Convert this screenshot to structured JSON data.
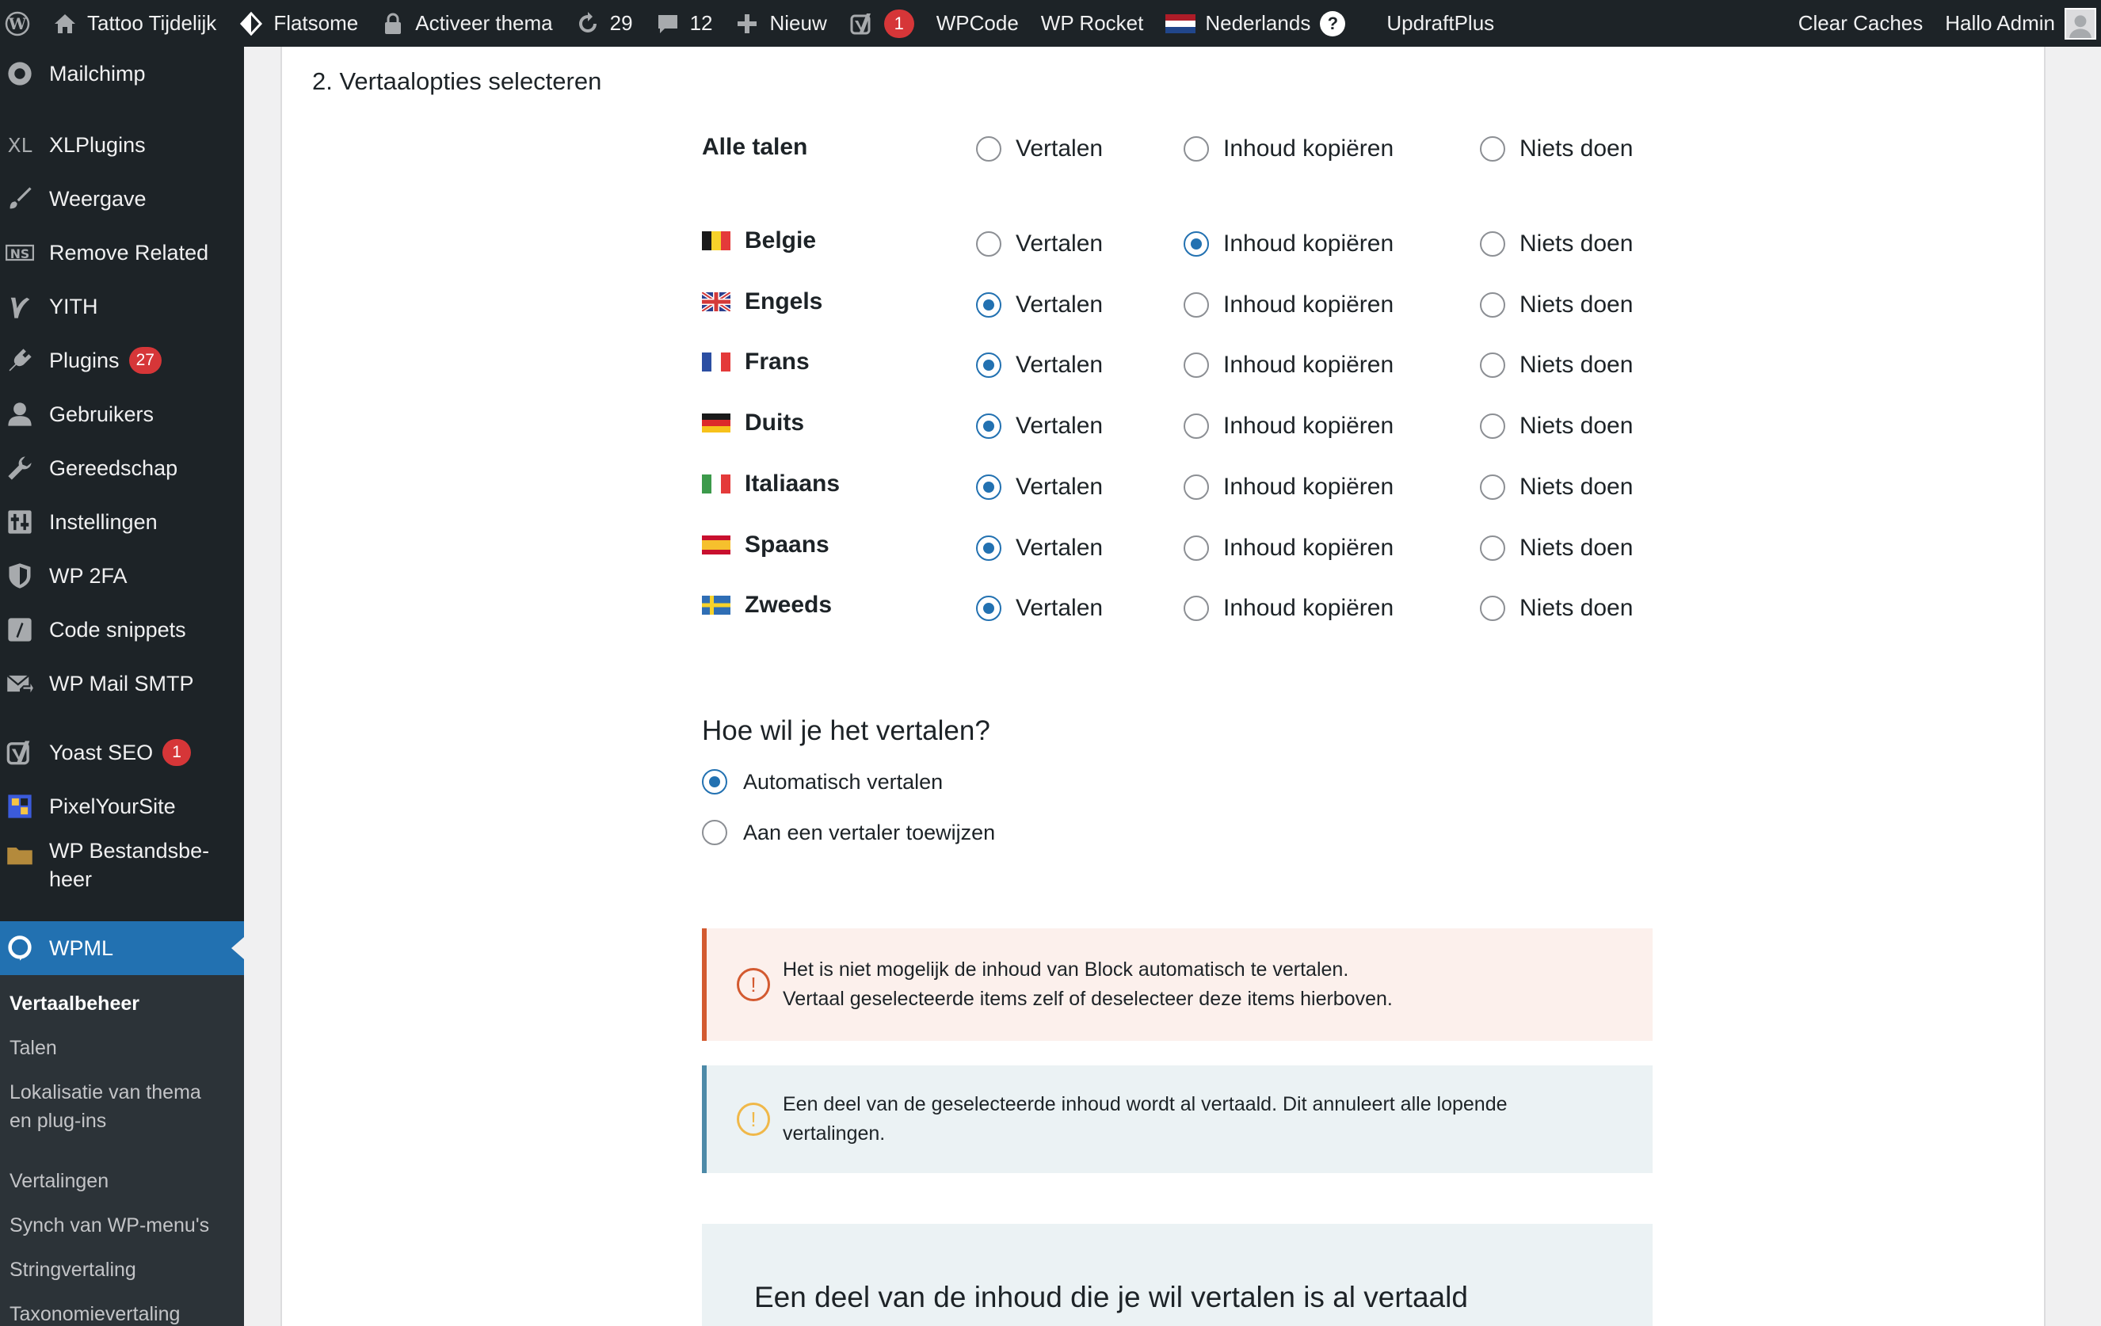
{
  "admin_bar": {
    "site_name": "Tattoo Tijdelijk",
    "theme": "Flatsome",
    "activate_theme": "Activeer thema",
    "updates_count": "29",
    "comments_count": "12",
    "new_label": "Nieuw",
    "yoast_badge": "1",
    "wpcode": "WPCode",
    "wp_rocket": "WP Rocket",
    "language": "Nederlands",
    "updraft": "UpdraftPlus",
    "clear_caches": "Clear Caches",
    "greeting": "Hallo Admin"
  },
  "sidebar": {
    "items": [
      {
        "label": "Mailchimp",
        "icon": "mailchimp-icon"
      },
      {
        "label": "XLPlugins",
        "icon": "xl-icon"
      },
      {
        "label": "Weergave",
        "icon": "paintbrush-icon"
      },
      {
        "label": "Remove Related",
        "icon": "ns-icon"
      },
      {
        "label": "YITH",
        "icon": "yith-icon"
      },
      {
        "label": "Plugins",
        "icon": "plugin-icon",
        "badge": "27"
      },
      {
        "label": "Gebruikers",
        "icon": "users-icon"
      },
      {
        "label": "Gereedschap",
        "icon": "wrench-icon"
      },
      {
        "label": "Instellingen",
        "icon": "settings-icon"
      },
      {
        "label": "WP 2FA",
        "icon": "shield-icon"
      },
      {
        "label": "Code snippets",
        "icon": "code-icon"
      },
      {
        "label": "WP Mail SMTP",
        "icon": "mail-icon"
      },
      {
        "label": "Yoast SEO",
        "icon": "yoast-icon",
        "badge": "1"
      },
      {
        "label": "PixelYourSite",
        "icon": "pixel-icon"
      },
      {
        "label": "WP Bestandsbe-",
        "label2": "heer",
        "icon": "folder-icon"
      },
      {
        "label": "WPML",
        "icon": "wpml-icon"
      }
    ],
    "submenu": [
      "Vertaalbeheer",
      "Talen",
      "Lokalisatie van thema",
      "en plug-ins",
      "Vertalingen",
      "Synch van WP-menu's",
      "Stringvertaling",
      "Taxonomievertaling"
    ]
  },
  "main": {
    "section_title": "2. Vertaalopties selecteren",
    "options": [
      "Vertalen",
      "Inhoud kopiëren",
      "Niets doen"
    ],
    "all_languages": {
      "label": "Alle talen",
      "selected": null
    },
    "languages": [
      {
        "name": "Belgie",
        "flag": "be",
        "selected": 1
      },
      {
        "name": "Engels",
        "flag": "gb",
        "selected": 0
      },
      {
        "name": "Frans",
        "flag": "fr",
        "selected": 0
      },
      {
        "name": "Duits",
        "flag": "de",
        "selected": 0
      },
      {
        "name": "Italiaans",
        "flag": "it",
        "selected": 0
      },
      {
        "name": "Spaans",
        "flag": "es",
        "selected": 0
      },
      {
        "name": "Zweeds",
        "flag": "se",
        "selected": 0
      }
    ],
    "how_title": "Hoe wil je het vertalen?",
    "how_options": [
      {
        "label": "Automatisch vertalen",
        "checked": true
      },
      {
        "label": "Aan een vertaler toewijzen",
        "checked": false
      }
    ],
    "error_notice": {
      "line1": "Het is niet mogelijk de inhoud van Block automatisch te vertalen.",
      "line2": "Vertaal geselecteerde items zelf of deselecteer deze items hierboven."
    },
    "warning_notice": {
      "line1": "Een deel van de geselecteerde inhoud wordt al vertaald. Dit annuleert alle lopende",
      "line2": "vertalingen."
    },
    "info_box_title": "Een deel van de inhoud die je wil vertalen is al vertaald"
  },
  "colors": {
    "admin_bg": "#1d2327",
    "accent": "#2271b1",
    "badge": "#d63638",
    "error_border": "#d35a30",
    "warning_border": "#4d8aa8"
  }
}
